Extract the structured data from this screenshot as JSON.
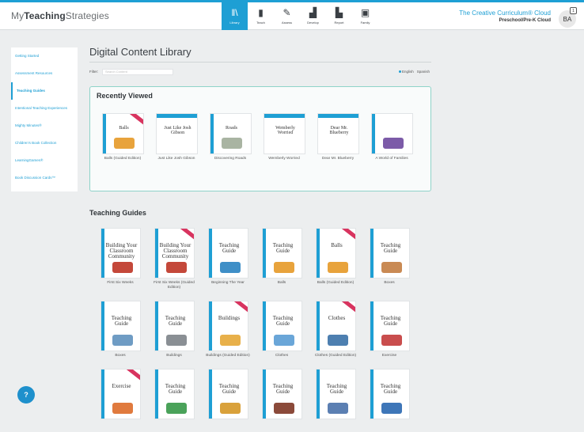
{
  "brand": {
    "logo_light": "My",
    "logo_bold": "Teaching",
    "logo_rest": "Strategies"
  },
  "nav": [
    {
      "label": "Library",
      "icon": "library-icon",
      "glyph": "ǁ\\",
      "active": true
    },
    {
      "label": "Teach",
      "icon": "book-icon",
      "glyph": "▮",
      "active": false
    },
    {
      "label": "Assess",
      "icon": "pencil-icon",
      "glyph": "✎",
      "active": false
    },
    {
      "label": "Develop",
      "icon": "stairs-icon",
      "glyph": "▟",
      "active": false
    },
    {
      "label": "Report",
      "icon": "bar-chart-icon",
      "glyph": "▙",
      "active": false
    },
    {
      "label": "Family",
      "icon": "image-icon",
      "glyph": "▣",
      "active": false
    }
  ],
  "header": {
    "cloud_title": "The Creative Curriculum® Cloud",
    "cloud_subtitle": "Preschool/Pre-K Cloud",
    "avatar_initials": "BA",
    "notification_count": "1"
  },
  "sidebar": {
    "items": [
      {
        "label": "Getting Started",
        "active": false
      },
      {
        "label": "Assessment Resources",
        "active": false
      },
      {
        "label": "Teaching Guides",
        "active": true
      },
      {
        "label": "Intentional Teaching Experiences",
        "active": false
      },
      {
        "label": "Mighty Minutes®",
        "active": false
      },
      {
        "label": "Children's Book Collection",
        "active": false
      },
      {
        "label": "LearningGames®",
        "active": false
      },
      {
        "label": "Book Discussion Cards™",
        "active": false
      }
    ]
  },
  "main": {
    "title": "Digital Content Library",
    "filter_label": "Filter:",
    "filter_placeholder": "Search Content",
    "lang_english": "English",
    "lang_spanish": "Spanish",
    "recent_title": "Recently Viewed",
    "guides_title": "Teaching Guides"
  },
  "recent": [
    {
      "caption": "Balls (Guided Edition)",
      "cover_title": "Balls",
      "art": "#e8a33c",
      "ribbon": true,
      "band": false
    },
    {
      "caption": "Just Like Josh Gibson",
      "cover_title": "Just Like Josh Gibson",
      "art": "#ffffff",
      "ribbon": false,
      "band": true
    },
    {
      "caption": "Discovering Roads",
      "cover_title": "Roads",
      "art": "#a9b4a2",
      "ribbon": false,
      "band": false
    },
    {
      "caption": "Wemberly Worried",
      "cover_title": "Wemberly Worried",
      "art": "#ffffff",
      "ribbon": false,
      "band": true
    },
    {
      "caption": "Dear Mr. Blueberry",
      "cover_title": "Dear Mr. Blueberry",
      "art": "#ffffff",
      "ribbon": false,
      "band": true
    },
    {
      "caption": "A World of Families",
      "cover_title": "",
      "art": "#7c5ba8",
      "ribbon": false,
      "band": false
    }
  ],
  "guides": [
    {
      "caption": "First Six Weeks",
      "cover_title": "Building Your Classroom Community",
      "art": "#c4483a",
      "ribbon": false
    },
    {
      "caption": "First Six Weeks (Guided Edition)",
      "cover_title": "Building Your Classroom Community",
      "art": "#c4483a",
      "ribbon": true
    },
    {
      "caption": "Beginning The Year",
      "cover_title": "Teaching Guide",
      "art": "#3f8fc7",
      "ribbon": false
    },
    {
      "caption": "Balls",
      "cover_title": "Teaching Guide",
      "art": "#e8a33c",
      "ribbon": false
    },
    {
      "caption": "Balls (Guided Edition)",
      "cover_title": "Balls",
      "art": "#e8a33c",
      "ribbon": true
    },
    {
      "caption": "Boxes",
      "cover_title": "Teaching Guide",
      "art": "#c98a54",
      "ribbon": false
    },
    {
      "caption": "Boxes",
      "cover_title": "Teaching Guide",
      "art": "#6f9cc4",
      "ribbon": false
    },
    {
      "caption": "Buildings",
      "cover_title": "Teaching Guide",
      "art": "#8a8f94",
      "ribbon": false
    },
    {
      "caption": "Buildings (Guided Edition)",
      "cover_title": "Buildings",
      "art": "#e8b04a",
      "ribbon": true
    },
    {
      "caption": "Clothes",
      "cover_title": "Teaching Guide",
      "art": "#6aa6d8",
      "ribbon": false
    },
    {
      "caption": "Clothes (Guided Edition)",
      "cover_title": "Clothes",
      "art": "#4d7fb0",
      "ribbon": true
    },
    {
      "caption": "Exercise",
      "cover_title": "Teaching Guide",
      "art": "#c94d4d",
      "ribbon": false
    },
    {
      "caption": "",
      "cover_title": "Exercise",
      "art": "#e07a3e",
      "ribbon": true
    },
    {
      "caption": "",
      "cover_title": "Teaching Guide",
      "art": "#4aa25a",
      "ribbon": false
    },
    {
      "caption": "",
      "cover_title": "Teaching Guide",
      "art": "#d9a13b",
      "ribbon": false
    },
    {
      "caption": "",
      "cover_title": "Teaching Guide",
      "art": "#8b4a3a",
      "ribbon": false
    },
    {
      "caption": "",
      "cover_title": "Teaching Guide",
      "art": "#5b7fb2",
      "ribbon": false
    },
    {
      "caption": "",
      "cover_title": "Teaching Guide",
      "art": "#3e76b8",
      "ribbon": false
    }
  ],
  "help_glyph": "?",
  "colors": {
    "accent": "#1e9fd4",
    "ribbon": "#d8345f",
    "teal_border": "#8fd3c9"
  }
}
